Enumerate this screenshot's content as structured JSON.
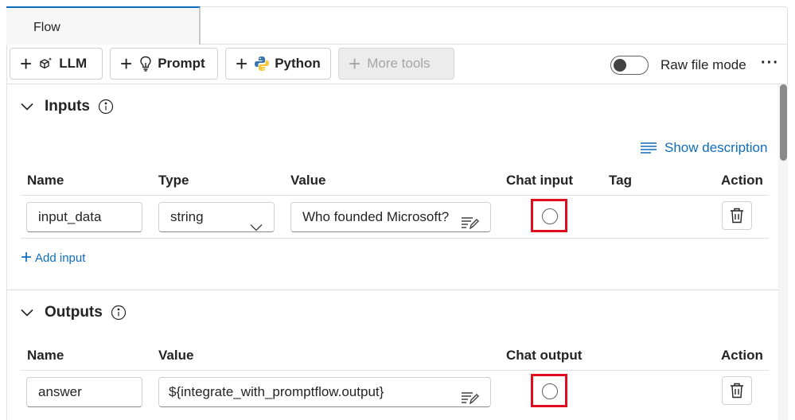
{
  "tabs": [
    {
      "label": "Flow"
    }
  ],
  "toolbar": {
    "llm_label": "LLM",
    "prompt_label": "Prompt",
    "python_label": "Python",
    "more_tools_label": "More tools",
    "raw_file_mode_label": "Raw file mode",
    "raw_file_mode_on": false,
    "more_label": "···"
  },
  "inputs": {
    "title": "Inputs",
    "show_description_label": "Show description",
    "columns": {
      "name": "Name",
      "type": "Type",
      "value": "Value",
      "chat_input": "Chat input",
      "tag": "Tag",
      "action": "Action"
    },
    "rows": [
      {
        "name": "input_data",
        "type": "string",
        "value": "Who founded Microsoft?",
        "chat_input": false
      }
    ],
    "add_input_label": "Add input"
  },
  "outputs": {
    "title": "Outputs",
    "columns": {
      "name": "Name",
      "value": "Value",
      "chat_output": "Chat output",
      "action": "Action"
    },
    "rows": [
      {
        "name": "answer",
        "value": "${integrate_with_promptflow.output}",
        "chat_output": false
      }
    ]
  },
  "colors": {
    "accent": "#0f6cbd",
    "highlight": "#e00d1f"
  }
}
